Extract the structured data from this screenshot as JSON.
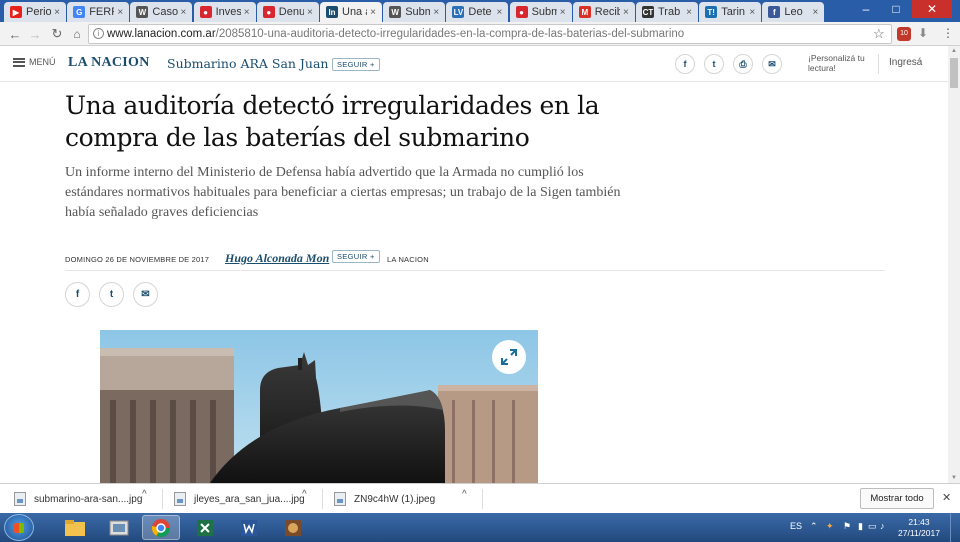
{
  "browser": {
    "tabs": [
      {
        "label": "Perio",
        "fav": "youtube",
        "color": "#e62117",
        "letter": "▶"
      },
      {
        "label": "FERR",
        "fav": "google",
        "color": "#4285f4",
        "letter": "G"
      },
      {
        "label": "Caso",
        "fav": "wikipedia",
        "color": "#555555",
        "letter": "W"
      },
      {
        "label": "Inves",
        "fav": "ambito",
        "color": "#d7262f",
        "letter": "●"
      },
      {
        "label": "Denu",
        "fav": "ambito",
        "color": "#d7262f",
        "letter": "●"
      },
      {
        "label": "Una a",
        "fav": "lanacion",
        "color": "#1b4d6e",
        "letter": "ln"
      },
      {
        "label": "Subm",
        "fav": "wikipedia",
        "color": "#555555",
        "letter": "W"
      },
      {
        "label": "Dete",
        "fav": "lavoz",
        "color": "#2b6fb5",
        "letter": "LV"
      },
      {
        "label": "Subm",
        "fav": "ambito",
        "color": "#d7262f",
        "letter": "●"
      },
      {
        "label": "Recib",
        "fav": "gmail",
        "color": "#d93025",
        "letter": "M"
      },
      {
        "label": "Trab",
        "fav": "ct",
        "color": "#333333",
        "letter": "CT"
      },
      {
        "label": "Tarin",
        "fav": "taringa",
        "color": "#1a6fb3",
        "letter": "T!"
      },
      {
        "label": "Leo",
        "fav": "facebook",
        "color": "#3b5998",
        "letter": "f"
      }
    ],
    "close_glyph": "×",
    "window_controls": {
      "minimize": "–",
      "maximize": "□",
      "close": "✕"
    },
    "nav": {
      "back": "←",
      "forward": "→",
      "reload": "↻"
    },
    "url_host": "www.lanacion.com.ar",
    "url_path": "/2085810-una-auditoria-detecto-irregularidades-en-la-compra-de-las-baterias-del-submarino",
    "star_glyph": "☆",
    "ext_badge": "10",
    "kebab_glyph": "⋮"
  },
  "site": {
    "menu_label": "MENÚ",
    "logo": "LA NACION",
    "section": "Submarino ARA San Juan",
    "follow_label": "SEGUIR +",
    "share_icons": [
      "facebook-icon",
      "twitter-icon",
      "print-icon",
      "mail-icon"
    ],
    "share_glyphs": [
      "f",
      "t",
      "⎙",
      "✉"
    ],
    "personaliza": "¡Personalizá tu lectura!",
    "login": "Ingresá"
  },
  "article": {
    "headline": "Una auditoría detectó irregularidades en la compra de las baterías del submarino",
    "subhead": "Un informe interno del Ministerio de Defensa había advertido que la Armada no cumplió los estándares normativos habituales para beneficiar a ciertas empresas; un trabajo de la Sigen también había señalado graves deficiencias",
    "date": "DOMINGO 26 DE NOVIEMBRE DE 2017",
    "author": "Hugo Alconada Mon",
    "follow_label": "SEGUIR +",
    "source": "LA NACION",
    "share_glyphs": [
      "f",
      "t",
      "✉"
    ]
  },
  "downloads": {
    "items": [
      {
        "name": "submarino-ara-san....jpg"
      },
      {
        "name": "jleyes_ara_san_jua....jpg"
      },
      {
        "name": "ZN9c4hW (1).jpeg"
      }
    ],
    "chevron": "^",
    "show_all": "Mostrar todo",
    "close_glyph": "✕"
  },
  "taskbar": {
    "lang": "ES",
    "time": "21:43",
    "date": "27/11/2017",
    "tray_glyphs": [
      "⌃",
      "✦",
      "⚑",
      "▮",
      "▭",
      "♪"
    ]
  }
}
